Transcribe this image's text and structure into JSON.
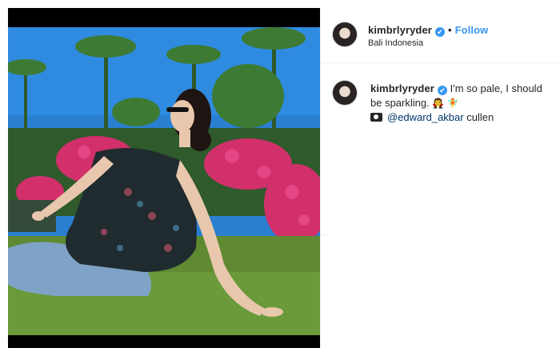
{
  "header": {
    "username": "kimbrlyryder",
    "verified_glyph": "✔",
    "separator": "•",
    "follow_label": "Follow",
    "location": "Bali Indonesia"
  },
  "caption": {
    "username": "kimbrlyryder",
    "verified_glyph": "✔",
    "text_1": "I'm so pale, I should be sparkling.",
    "emoji_1": "🧛",
    "emoji_2": "🧚",
    "mention": "@edward_akbar",
    "text_2": "cullen"
  },
  "icons": {
    "verified": "verified-badge-icon",
    "camera": "camera-icon"
  },
  "colors": {
    "accent": "#3897f0",
    "text": "#262626",
    "mention": "#003569",
    "border": "#efefef"
  }
}
